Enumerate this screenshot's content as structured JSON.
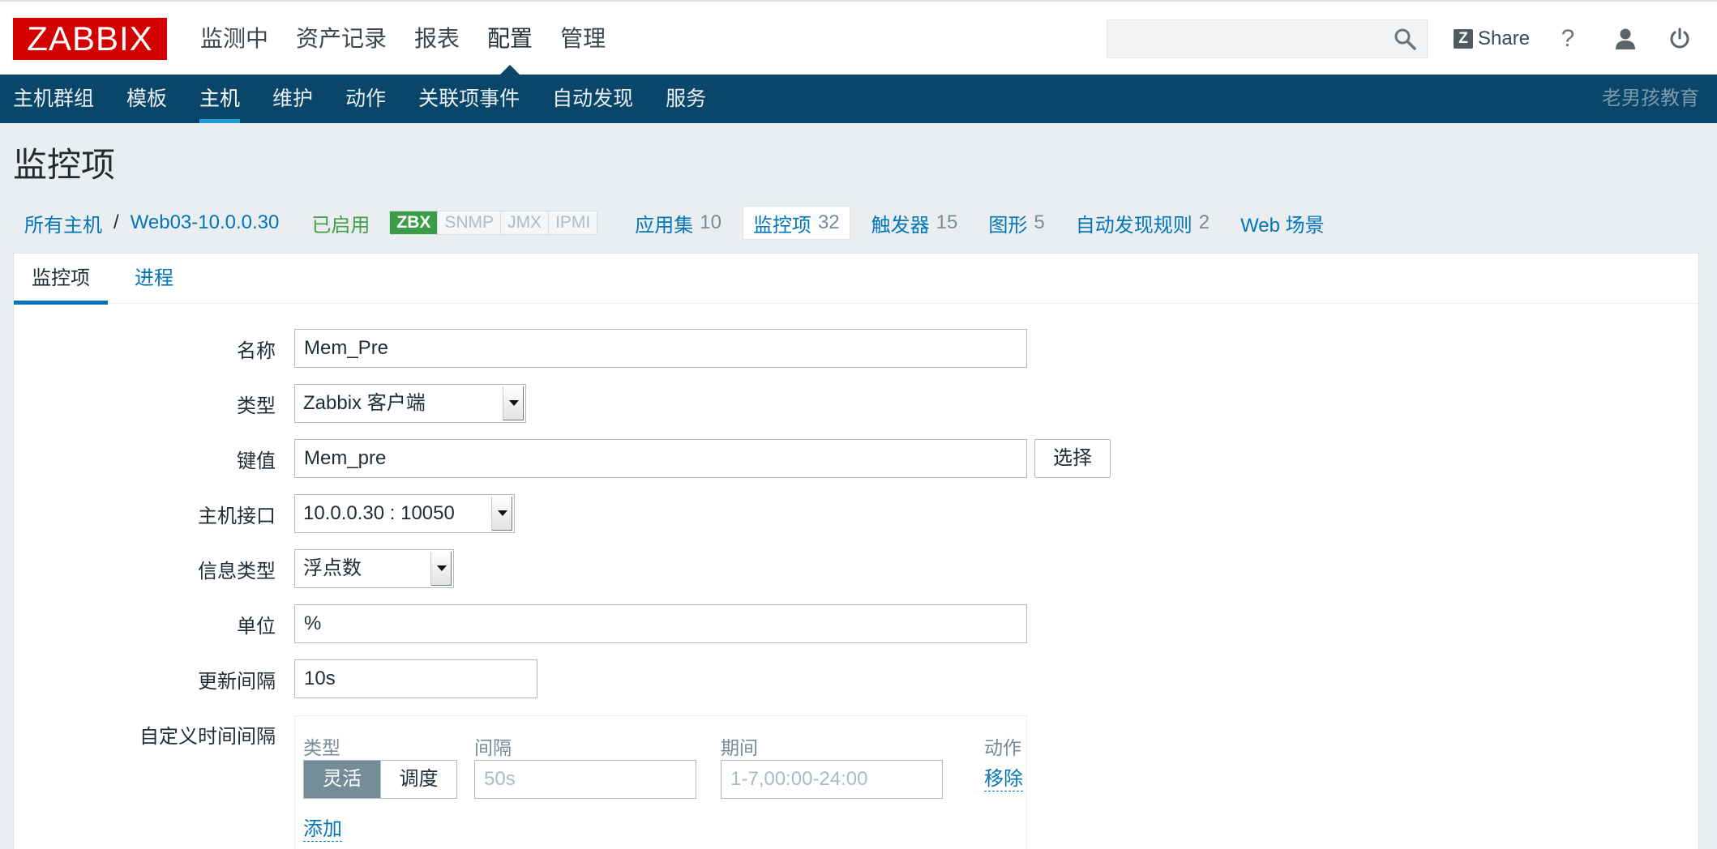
{
  "brand": {
    "logo_text": "ZABBIX"
  },
  "top_nav": [
    {
      "label": "监测中"
    },
    {
      "label": "资产记录"
    },
    {
      "label": "报表"
    },
    {
      "label": "配置"
    },
    {
      "label": "管理"
    }
  ],
  "toolbar": {
    "search_value": "",
    "share_label": "Share",
    "share_icon_letter": "Z",
    "help_label": "?"
  },
  "sub_nav": [
    {
      "label": "主机群组"
    },
    {
      "label": "模板"
    },
    {
      "label": "主机"
    },
    {
      "label": "维护"
    },
    {
      "label": "动作"
    },
    {
      "label": "关联项事件"
    },
    {
      "label": "自动发现"
    },
    {
      "label": "服务"
    }
  ],
  "sub_nav_right": "老男孩教育",
  "page_title": "监控项",
  "breadcrumb": {
    "all_hosts": "所有主机",
    "separator": "/",
    "host": "Web03-10.0.0.30",
    "status": "已启用",
    "availability": [
      "ZBX",
      "SNMP",
      "JMX",
      "IPMI"
    ],
    "tabs": [
      {
        "label": "应用集",
        "count": "10"
      },
      {
        "label": "监控项",
        "count": "32"
      },
      {
        "label": "触发器",
        "count": "15"
      },
      {
        "label": "图形",
        "count": "5"
      },
      {
        "label": "自动发现规则",
        "count": "2"
      },
      {
        "label": "Web 场景",
        "count": ""
      }
    ]
  },
  "form_tabs": [
    {
      "label": "监控项"
    },
    {
      "label": "进程"
    }
  ],
  "form": {
    "name": {
      "label": "名称",
      "value": "Mem_Pre"
    },
    "type": {
      "label": "类型",
      "value": "Zabbix 客户端"
    },
    "key": {
      "label": "键值",
      "value": "Mem_pre",
      "button": "选择"
    },
    "interface": {
      "label": "主机接口",
      "value": "10.0.0.30 : 10050"
    },
    "info_type": {
      "label": "信息类型",
      "value": "浮点数"
    },
    "units": {
      "label": "单位",
      "value": "%"
    },
    "update_interval": {
      "label": "更新间隔",
      "value": "10s"
    },
    "custom_intervals": {
      "label": "自定义时间间隔",
      "headers": {
        "type": "类型",
        "interval": "间隔",
        "period": "期间",
        "action": "动作"
      },
      "row": {
        "flexible": "灵活",
        "scheduling": "调度",
        "interval_placeholder": "50s",
        "period_placeholder": "1-7,00:00-24:00",
        "remove": "移除"
      },
      "add": "添加"
    }
  },
  "colors": {
    "brand_red": "#d40000",
    "nav_blue": "#0a466a",
    "link_blue": "#0275b8",
    "enabled_green": "#429e47"
  }
}
